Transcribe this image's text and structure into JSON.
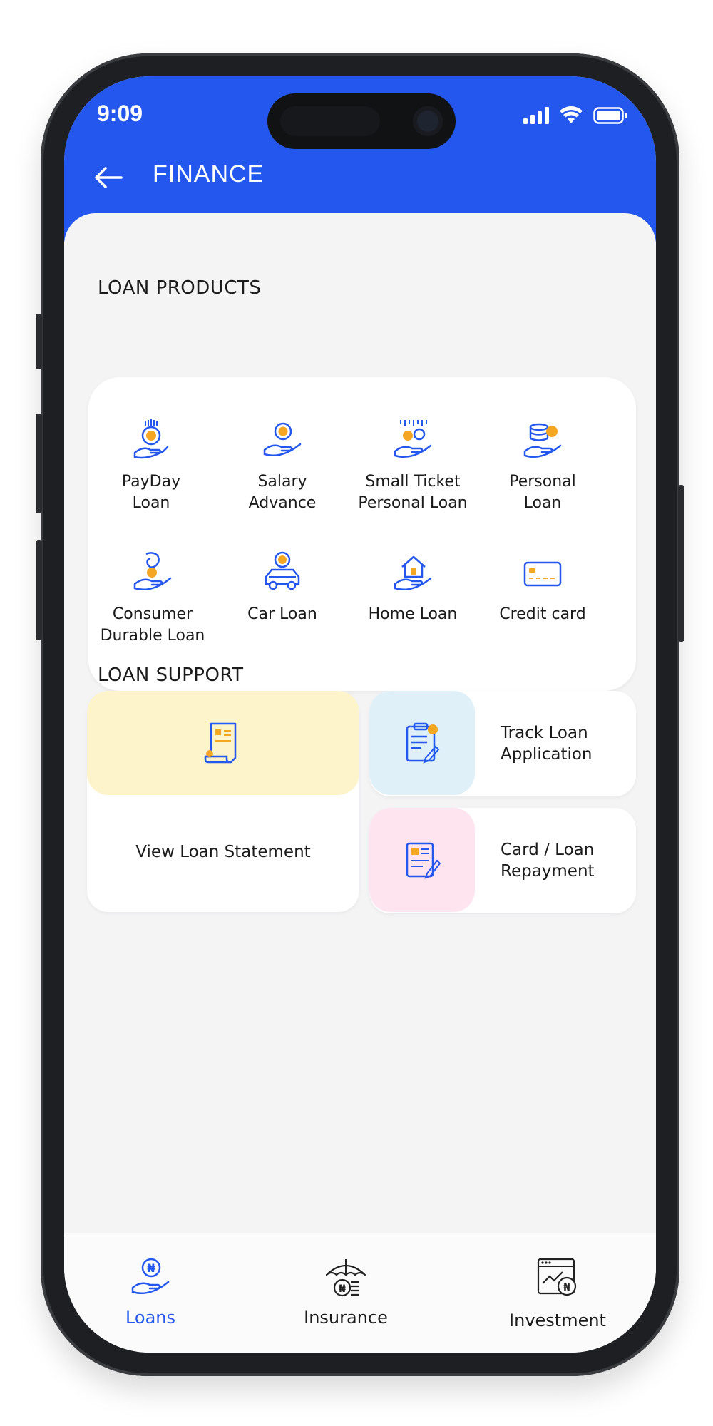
{
  "status_bar": {
    "time": "9:09"
  },
  "header": {
    "title": "FINANCE"
  },
  "loan_products": {
    "title": "LOAN PRODUCTS",
    "items": [
      {
        "label": "PayDay\nLoan",
        "icon": "payday-loan-icon"
      },
      {
        "label": "Salary\nAdvance",
        "icon": "salary-advance-icon"
      },
      {
        "label": "Small Ticket\nPersonal Loan",
        "icon": "small-ticket-loan-icon"
      },
      {
        "label": "Personal\nLoan",
        "icon": "personal-loan-icon"
      },
      {
        "label": "Consumer\nDurable Loan",
        "icon": "consumer-durable-loan-icon"
      },
      {
        "label": "Car Loan",
        "icon": "car-loan-icon"
      },
      {
        "label": "Home Loan",
        "icon": "home-loan-icon"
      },
      {
        "label": "Credit card",
        "icon": "credit-card-icon"
      }
    ]
  },
  "loan_support": {
    "title": "LOAN SUPPORT",
    "items": [
      {
        "label": "View Loan Statement",
        "icon": "loan-statement-icon"
      },
      {
        "label": "Track Loan\nApplication",
        "icon": "track-application-icon"
      },
      {
        "label": "Card / Loan\nRepayment",
        "icon": "repayment-icon"
      }
    ]
  },
  "bottom_nav": {
    "items": [
      {
        "label": "Loans",
        "icon": "loans-icon",
        "active": true
      },
      {
        "label": "Insurance",
        "icon": "insurance-icon",
        "active": false
      },
      {
        "label": "Investment",
        "icon": "investment-icon",
        "active": false
      }
    ]
  },
  "colors": {
    "primary": "#2457ee",
    "accent_orange": "#f5a623",
    "statement_tile": "#fdf4cc",
    "track_tile": "#dff0f8",
    "repayment_tile": "#fde4ef"
  }
}
